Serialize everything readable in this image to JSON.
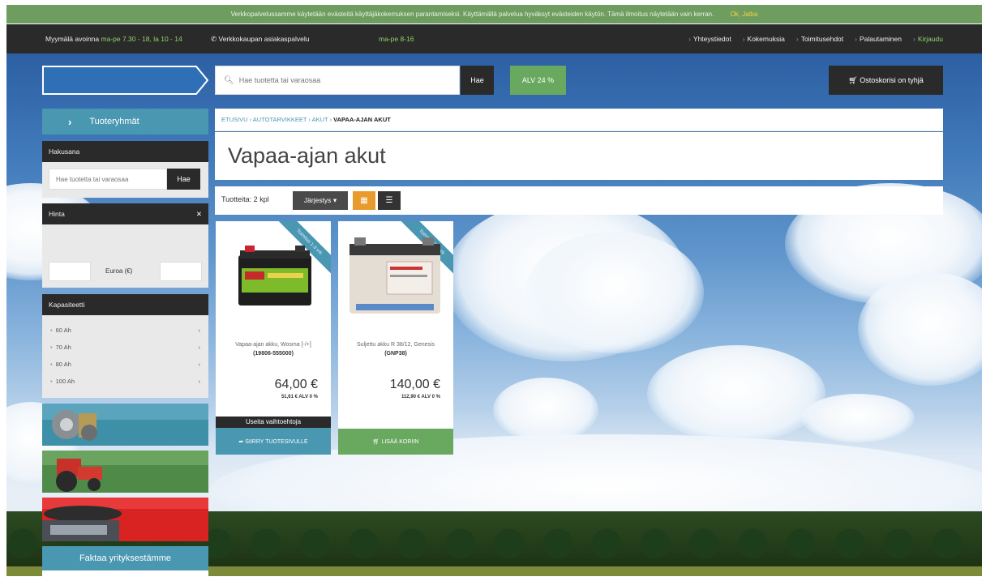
{
  "cookie_bar": {
    "text": "Verkkopalvelussamme käytetään evästeitä käyttäjäkokemuksen parantamiseksi. Käyttämällä palvelua hyväksyt evästeiden käytön. Tämä ilmoitus näytetään vain kerran.",
    "accept": "Ok, Jatka"
  },
  "topbar": {
    "store_open_label": "Myymälä avoinna",
    "store_open_hours": "ma-pe 7.30 - 18, la 10 - 14",
    "service_label": "Verkkokaupan asiakaspalvelu",
    "service_hours": "ma-pe 8-16",
    "links": [
      "Yhteystiedot",
      "Kokemuksia",
      "Toimitusehdot",
      "Palautaminen"
    ],
    "login": "Kirjaudu"
  },
  "header": {
    "search_placeholder": "Hae tuotetta tai varaosaa",
    "search_button": "Hae",
    "vat_button": "ALV 24 %",
    "cart_button": "Ostoskorisi on tyhjä"
  },
  "sidebar": {
    "groups_label": "Tuoteryhmät",
    "search_title": "Hakusana",
    "search_placeholder": "Hae tuotetta tai varaosaa",
    "search_button": "Hae",
    "price_title": "Hinta",
    "price_unit": "Euroa (€)",
    "capacity_title": "Kapasiteetti",
    "capacity_items": [
      "60 Ah",
      "70 Ah",
      "80 Ah",
      "100 Ah"
    ],
    "facts_label": "Faktaa yrityksestämme"
  },
  "main": {
    "breadcrumb": [
      "ETUSIVU",
      "AUTOTARVIKKEET",
      "AKUT"
    ],
    "breadcrumb_current": "VAPAA-AJAN AKUT",
    "title": "Vapaa-ajan akut",
    "count": "Tuotteita: 2 kpl",
    "sort_button": "Järjestys"
  },
  "products": [
    {
      "ribbon": "Toimitus 1-3 vrk",
      "name": "Vapaa-ajan akku, Wosma [-/+]",
      "code": "(19806-555000)",
      "price": "64,00 €",
      "vat_note": "51,61 € ALV 0 %",
      "variants": "Useita vaihtoehtoja",
      "cta": "SIIRRY TUOTESIVULLE"
    },
    {
      "ribbon": "Toimitus 1-3 vrk",
      "name": "Suljettu akku R 38/12, Genesis",
      "code": "(GNP38)",
      "price": "140,00 €",
      "vat_note": "112,90 € ALV 0 %",
      "cta": "LISÄÄ KORIIN"
    }
  ],
  "colors": {
    "accent_blue": "#4a97b1",
    "accent_green": "#69a85f",
    "orange": "#e89a2d",
    "dark": "#2a2a2a"
  }
}
